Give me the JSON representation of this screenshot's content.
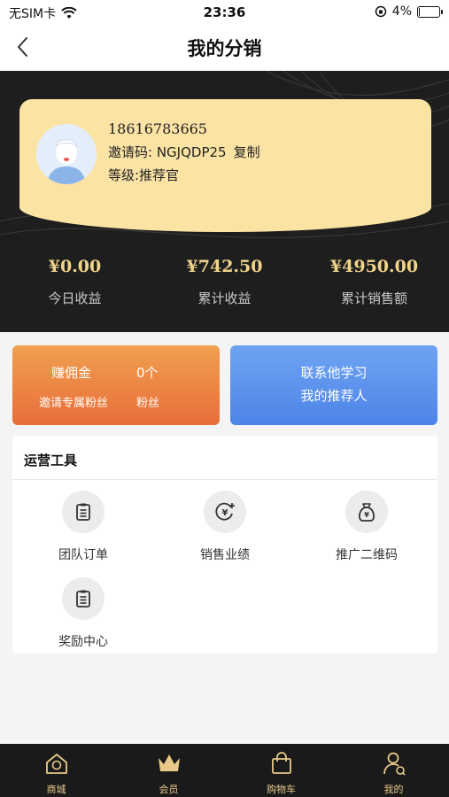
{
  "status_bar": {
    "carrier": "无SIM卡",
    "time": "23:36",
    "battery": "4%",
    "battery_level": 0.04
  },
  "nav": {
    "title": "我的分销",
    "back_icon": "chevron-left-icon"
  },
  "profile": {
    "phone": "18616783665",
    "invite_label": "邀请码: NGJQDP25",
    "copy_label": "复制",
    "level": "等级:推荐官",
    "avatar_icon": "user-avatar-icon"
  },
  "stats": [
    {
      "value": "¥0.00",
      "label": "今日收益"
    },
    {
      "value": "¥742.50",
      "label": "累计收益"
    },
    {
      "value": "¥4950.00",
      "label": "累计销售额"
    }
  ],
  "promo_card": {
    "title": "赚佣金",
    "subtitle": "邀请专属粉丝",
    "count": "0个",
    "count_label": "粉丝"
  },
  "contact_card": {
    "line1": "联系他学习",
    "line2": "我的推荐人"
  },
  "tools": {
    "title": "运营工具",
    "items": [
      {
        "label": "团队订单",
        "icon": "clipboard-icon"
      },
      {
        "label": "销售业绩",
        "icon": "yen-coin-icon"
      },
      {
        "label": "推广二维码",
        "icon": "money-bag-icon"
      },
      {
        "label": "奖励中心",
        "icon": "clipboard-icon"
      }
    ]
  },
  "tab_bar": {
    "items": [
      {
        "label": "商城",
        "icon": "home-icon"
      },
      {
        "label": "会员",
        "icon": "crown-icon"
      },
      {
        "label": "购物车",
        "icon": "shopping-bag-icon"
      },
      {
        "label": "我的",
        "icon": "user-icon"
      }
    ]
  },
  "colors": {
    "gold": "#f0d48a",
    "card_yellow": "#fbe3a4",
    "dark": "#1e1e1e",
    "orange": "#e86e3a",
    "blue": "#4d84e8"
  }
}
